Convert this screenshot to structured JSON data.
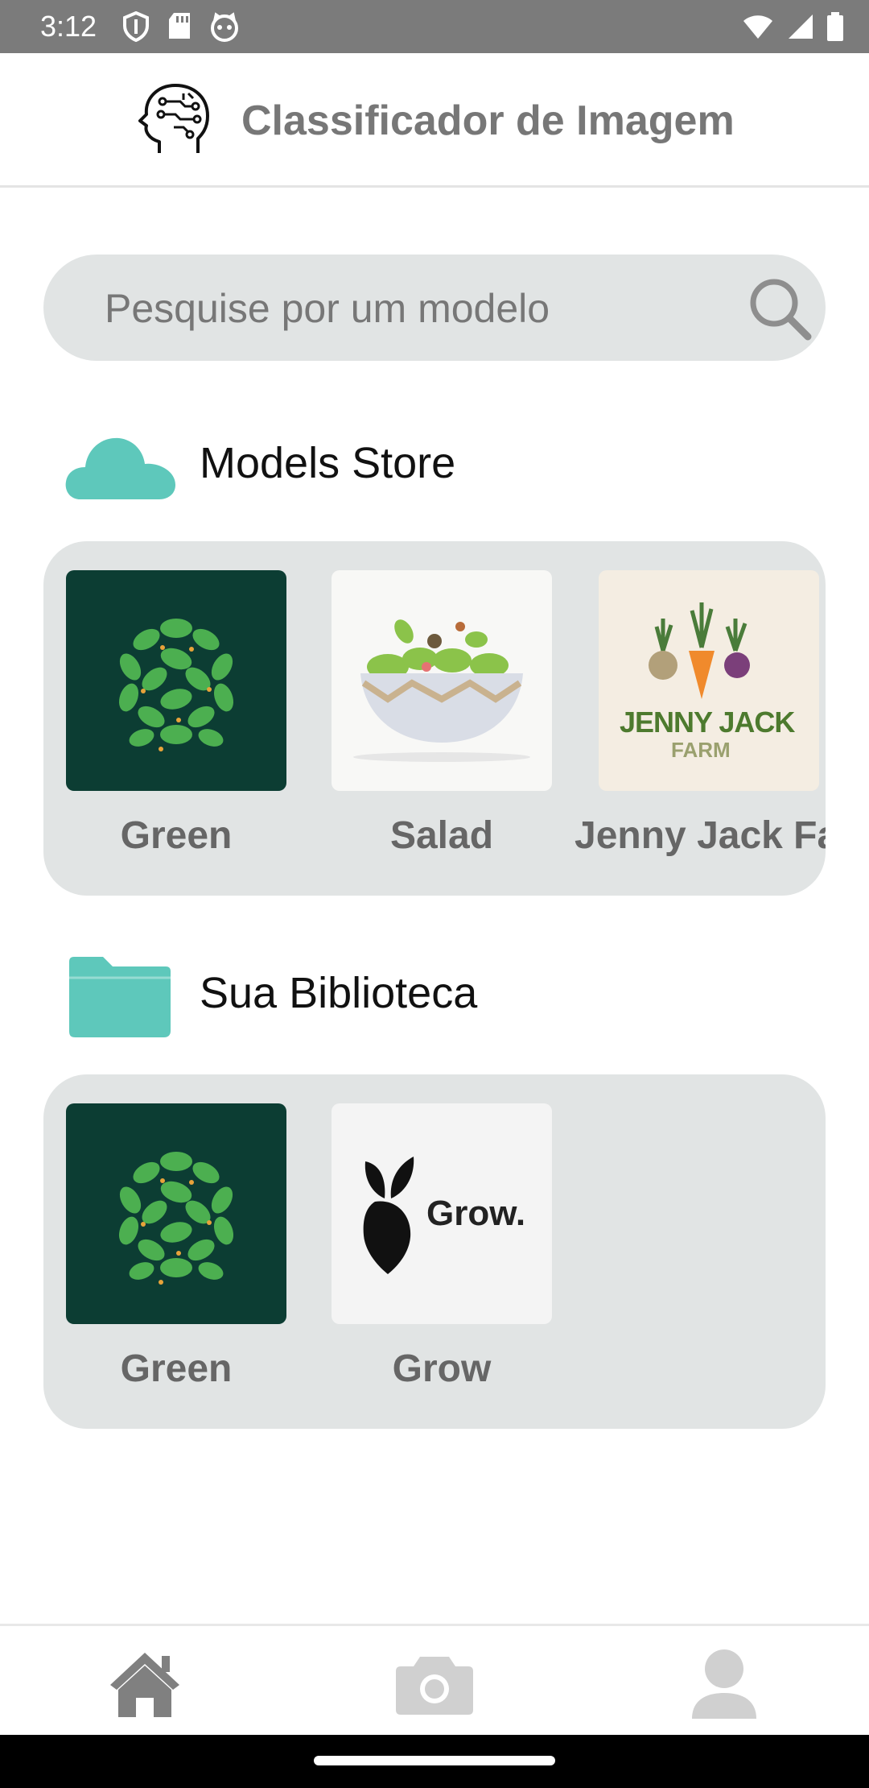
{
  "status_bar": {
    "time": "3:12",
    "icons_left": [
      "shield-icon",
      "sd-card-icon",
      "cat-face-icon"
    ],
    "icons_right": [
      "wifi-icon",
      "signal-icon",
      "battery-icon"
    ]
  },
  "header": {
    "title": "Classificador de Imagem",
    "logo": "brain-circuit-icon"
  },
  "search": {
    "placeholder": "Pesquise por um modelo",
    "value": ""
  },
  "models_store": {
    "title": "Models Store",
    "icon": "cloud-icon",
    "icon_color": "#5ec8bb",
    "items": [
      {
        "label": "Green",
        "thumb": "green-leaves-logo"
      },
      {
        "label": "Salad",
        "thumb": "salad-bowl-logo"
      },
      {
        "label": "Jenny Jack Farm",
        "thumb": "jenny-jack-farm-logo",
        "logo_text_1": "JENNY JACK",
        "logo_text_2": "FARM"
      }
    ]
  },
  "library": {
    "title": "Sua Biblioteca",
    "icon": "folder-icon",
    "icon_color": "#5ec8bb",
    "items": [
      {
        "label": "Green",
        "thumb": "green-leaves-logo"
      },
      {
        "label": "Grow",
        "thumb": "grow-logo",
        "logo_text": "Grow."
      }
    ]
  },
  "bottom_nav": {
    "items": [
      {
        "name": "home",
        "icon": "home-icon",
        "active": true
      },
      {
        "name": "camera",
        "icon": "camera-icon",
        "active": false
      },
      {
        "name": "profile",
        "icon": "person-icon",
        "active": false
      }
    ],
    "active_color": "#808080",
    "inactive_color": "#d0d0d0"
  }
}
